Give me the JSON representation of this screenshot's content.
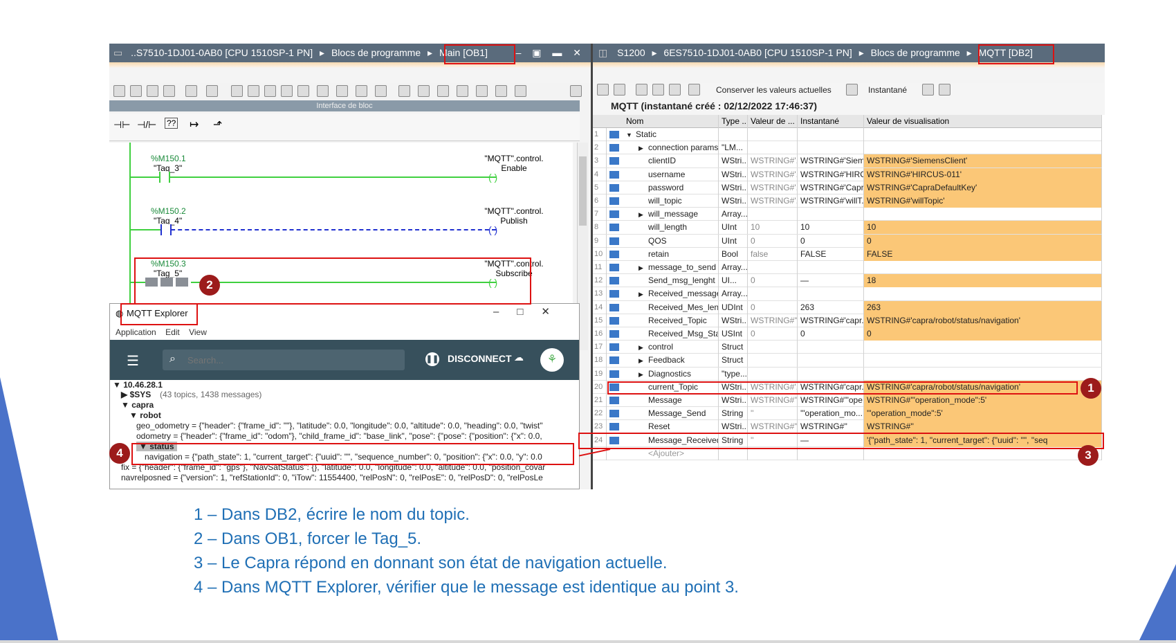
{
  "left_pane": {
    "title_prefix": "..S7510-1DJ01-0AB0 [CPU 1510SP-1 PN]",
    "breadcrumb_sep": "▸",
    "breadcrumb_1": "Blocs de programme",
    "breadcrumb_2": "Main [OB1]",
    "interface_label": "Interface de bloc",
    "rungs": [
      {
        "addr": "%M150.1",
        "tag": "\"Tag_3\"",
        "coil1": "\"MQTT\".control.",
        "coil2": "Enable"
      },
      {
        "addr": "%M150.2",
        "tag": "\"Tag_4\"",
        "coil1": "\"MQTT\".control.",
        "coil2": "Publish"
      },
      {
        "addr": "%M150.3",
        "tag": "\"Tag_5\"",
        "coil1": "\"MQTT\".control.",
        "coil2": "Subscribe"
      }
    ]
  },
  "right_pane": {
    "title_1": "S1200",
    "title_2": "6ES7510-1DJ01-0AB0 [CPU 1510SP-1 PN]",
    "title_3": "Blocs de programme",
    "title_4": "MQTT [DB2]",
    "toolbar_keep": "Conserver les valeurs actuelles",
    "toolbar_snapshot": "Instantané",
    "table_title": "MQTT (instantané créé : 02/12/2022 17:46:37)",
    "columns": [
      "Nom",
      "Type ..",
      "Valeur de ...",
      "Instantané",
      "Valeur de visualisation"
    ],
    "rows": [
      {
        "n": "1",
        "name": "Static",
        "type": "",
        "val": "",
        "snap": "",
        "watch": "",
        "indent": 0,
        "arrow": "▼",
        "hl": false
      },
      {
        "n": "2",
        "name": "connection params",
        "type": "\"LM...",
        "val": "",
        "snap": "",
        "watch": "",
        "indent": 1,
        "arrow": "▶",
        "hl": false
      },
      {
        "n": "3",
        "name": "clientID",
        "type": "WStri...",
        "val": "WSTRING#'...",
        "snap": "WSTRING#'Siem...",
        "watch": "WSTRING#'SiemensClient'",
        "indent": 1,
        "arrow": "",
        "hl": true
      },
      {
        "n": "4",
        "name": "username",
        "type": "WStri...",
        "val": "WSTRING#'...",
        "snap": "WSTRING#'HIRC...",
        "watch": "WSTRING#'HIRCUS-011'",
        "indent": 1,
        "arrow": "",
        "hl": true
      },
      {
        "n": "5",
        "name": "password",
        "type": "WStri...",
        "val": "WSTRING#'...",
        "snap": "WSTRING#'Capr...",
        "watch": "WSTRING#'CapraDefaultKey'",
        "indent": 1,
        "arrow": "",
        "hl": true
      },
      {
        "n": "6",
        "name": "will_topic",
        "type": "WStri...",
        "val": "WSTRING#'...",
        "snap": "WSTRING#'willT...",
        "watch": "WSTRING#'willTopic'",
        "indent": 1,
        "arrow": "",
        "hl": true
      },
      {
        "n": "7",
        "name": "will_message",
        "type": "Array...",
        "val": "",
        "snap": "",
        "watch": "",
        "indent": 1,
        "arrow": "▶",
        "hl": false
      },
      {
        "n": "8",
        "name": "will_length",
        "type": "UInt",
        "val": "10",
        "snap": "10",
        "watch": "10",
        "indent": 1,
        "arrow": "",
        "hl": true
      },
      {
        "n": "9",
        "name": "QOS",
        "type": "UInt",
        "val": "0",
        "snap": "0",
        "watch": "0",
        "indent": 1,
        "arrow": "",
        "hl": true
      },
      {
        "n": "10",
        "name": "retain",
        "type": "Bool",
        "val": "false",
        "snap": "FALSE",
        "watch": "FALSE",
        "indent": 1,
        "arrow": "",
        "hl": true
      },
      {
        "n": "11",
        "name": "message_to_send",
        "type": "Array...",
        "val": "",
        "snap": "",
        "watch": "",
        "indent": 1,
        "arrow": "▶",
        "hl": false
      },
      {
        "n": "12",
        "name": "Send_msg_lenght",
        "type": "UI...",
        "val": "0",
        "snap": "—",
        "watch": "18",
        "indent": 1,
        "arrow": "",
        "hl": true
      },
      {
        "n": "13",
        "name": "Received_message",
        "type": "Array...",
        "val": "",
        "snap": "",
        "watch": "",
        "indent": 1,
        "arrow": "▶",
        "hl": false
      },
      {
        "n": "14",
        "name": "Received_Mes_length",
        "type": "UDInt",
        "val": "0",
        "snap": "263",
        "watch": "263",
        "indent": 1,
        "arrow": "",
        "hl": true
      },
      {
        "n": "15",
        "name": "Received_Topic",
        "type": "WStri...",
        "val": "WSTRING#''",
        "snap": "WSTRING#'capr...",
        "watch": "WSTRING#'capra/robot/status/navigation'",
        "indent": 1,
        "arrow": "",
        "hl": true
      },
      {
        "n": "16",
        "name": "Received_Msg_Status",
        "type": "USInt",
        "val": "0",
        "snap": "0",
        "watch": "0",
        "indent": 1,
        "arrow": "",
        "hl": true
      },
      {
        "n": "17",
        "name": "control",
        "type": "Struct",
        "val": "",
        "snap": "",
        "watch": "",
        "indent": 1,
        "arrow": "▶",
        "hl": false
      },
      {
        "n": "18",
        "name": "Feedback",
        "type": "Struct",
        "val": "",
        "snap": "",
        "watch": "",
        "indent": 1,
        "arrow": "▶",
        "hl": false
      },
      {
        "n": "19",
        "name": "Diagnostics",
        "type": "\"type...",
        "val": "",
        "snap": "",
        "watch": "",
        "indent": 1,
        "arrow": "▶",
        "hl": false
      },
      {
        "n": "20",
        "name": "current_Topic",
        "type": "WStri...",
        "val": "WSTRING#'...",
        "snap": "WSTRING#'capr...",
        "watch": "WSTRING#'capra/robot/status/navigation'",
        "indent": 1,
        "arrow": "",
        "hl": true
      },
      {
        "n": "21",
        "name": "Message",
        "type": "WStri...",
        "val": "WSTRING#''",
        "snap": "WSTRING#'\"ope...",
        "watch": "WSTRING#'\"operation_mode\":5'",
        "indent": 1,
        "arrow": "",
        "hl": true
      },
      {
        "n": "22",
        "name": "Message_Send",
        "type": "String",
        "val": "''",
        "snap": "'\"operation_mo...",
        "watch": "'\"operation_mode\":5'",
        "indent": 1,
        "arrow": "",
        "hl": true
      },
      {
        "n": "23",
        "name": "Reset",
        "type": "WStri...",
        "val": "WSTRING#''",
        "snap": "WSTRING#''",
        "watch": "WSTRING#''",
        "indent": 1,
        "arrow": "",
        "hl": true
      },
      {
        "n": "24",
        "name": "Message_Received",
        "type": "String",
        "val": "''",
        "snap": "—",
        "watch": "'{\"path_state\": 1, \"current_target\": {\"uuid\": \"\", \"seq",
        "indent": 1,
        "arrow": "",
        "hl": true
      },
      {
        "n": "",
        "name": "<Ajouter>",
        "type": "",
        "val": "",
        "snap": "",
        "watch": "",
        "indent": 1,
        "arrow": "",
        "hl": false
      }
    ]
  },
  "mqtt_explorer": {
    "title": "MQTT Explorer",
    "menu": [
      "Application",
      "Edit",
      "View"
    ],
    "search_placeholder": "Search...",
    "disconnect": "DISCONNECT",
    "tree": {
      "host": "▼ 10.46.28.1",
      "sys": "▶ $SYS",
      "sys_info": "(43 topics, 1438 messages)",
      "capra": "▼ capra",
      "robot": "▼ robot",
      "geo": "geo_odometry = {\"header\": {\"frame_id\": \"\"}, \"latitude\": 0.0, \"longitude\": 0.0, \"altitude\": 0.0, \"heading\": 0.0, \"twist\"",
      "odometry": "odometry = {\"header\": {\"frame_id\": \"odom\"}, \"child_frame_id\": \"base_link\", \"pose\": {\"pose\": {\"position\": {\"x\": 0.0,",
      "status": "▼ status",
      "navigation": "navigation = {\"path_state\": 1, \"current_target\": {\"uuid\": \"\", \"sequence_number\": 0, \"position\": {\"x\": 0.0, \"y\": 0.0",
      "fix": "fix = {\"header\": {\"frame_id\": \"gps\"}, \"NavSatStatus\": {}, \"latitude\": 0.0, \"longitude\": 0.0, \"altitude\": 0.0, \"position_covar",
      "navrel": "navrelposned = {\"version\": 1, \"refStationId\": 0, \"iTow\": 11554400, \"relPosN\": 0, \"relPosE\": 0, \"relPosD\": 0, \"relPosLe"
    }
  },
  "badges": [
    "1",
    "2",
    "3",
    "4"
  ],
  "notes": [
    "1 – Dans DB2, écrire le nom du topic.",
    "2 – Dans OB1, forcer le Tag_5.",
    "3 – Le Capra répond en donnant son état de navigation actuelle.",
    "4 – Dans MQTT Explorer, vérifier que le message est identique au point 3."
  ],
  "colors": {
    "accent_blue": "#4a72c9",
    "highlight": "#fbc777",
    "badge": "#9c1b1b",
    "note_text": "#1f6fb5",
    "mqtt_header": "#37505c"
  }
}
